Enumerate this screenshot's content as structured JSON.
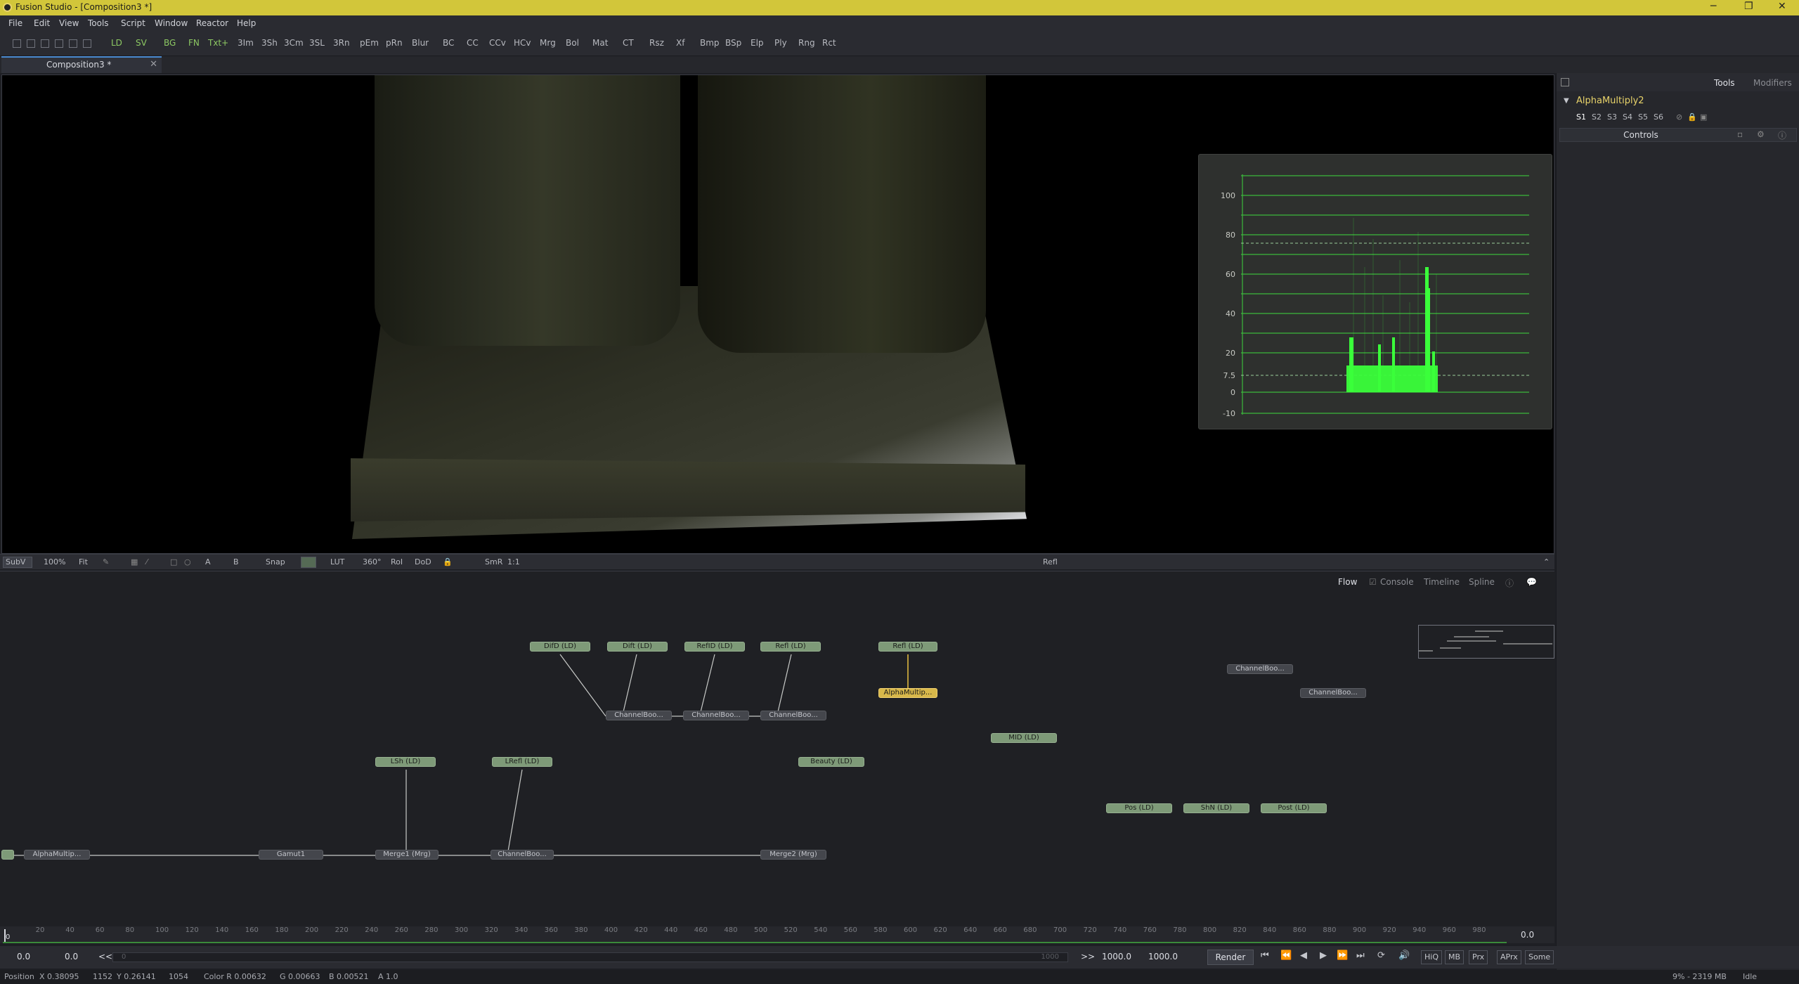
{
  "titlebar": {
    "title": "Fusion Studio - [Composition3 *]",
    "minimize": "─",
    "restore": "❐",
    "close": "✕"
  },
  "menu": [
    "File",
    "Edit",
    "View",
    "Tools",
    "Script",
    "Window",
    "Reactor",
    "Help"
  ],
  "toolbar": [
    "LD",
    "SV",
    "BG",
    "FN",
    "Txt+",
    "3Im",
    "3Sh",
    "3Cm",
    "3SL",
    "3Rn",
    "pEm",
    "pRn",
    "Blur",
    "BC",
    "CC",
    "CCv",
    "HCv",
    "Mrg",
    "Bol",
    "Mat",
    "CT",
    "Rsz",
    "Xf",
    "Bmp",
    "BSp",
    "Elp",
    "Ply",
    "Rng",
    "Rct"
  ],
  "tab": {
    "label": "Composition3 *",
    "close": "✕"
  },
  "scope": {
    "labels": [
      "100",
      "80",
      "60",
      "40",
      "20",
      "7.5",
      "0",
      "-10"
    ]
  },
  "viewer_toolbar": {
    "subv": "SubV",
    "zoom": "100%",
    "fit": "Fit",
    "a": "A",
    "b": "B",
    "snap": "Snap",
    "lut": "LUT",
    "deg": "360°",
    "roi": "RoI",
    "dod": "DoD",
    "smr": "SmR",
    "ratio": "1:1",
    "center_label": "Refl",
    "expand": "⌃"
  },
  "inspector": {
    "tabs": [
      "Tools",
      "Modifiers"
    ],
    "title": "AlphaMultiply2",
    "versions": [
      "S1",
      "S2",
      "S3",
      "S4",
      "S5",
      "S6"
    ],
    "controls_label": "Controls"
  },
  "flow": {
    "tabs": [
      "Flow",
      "Console",
      "Timeline",
      "Spline"
    ],
    "nodes": [
      "DifD (LD)",
      "Dift (LD)",
      "RefID (LD)",
      "Refl (LD)",
      "Refl (LD)",
      "AlphaMultip...",
      "ChannelBoo...",
      "ChannelBoo...",
      "ChannelBoo...",
      "ChannelBoo...",
      "ChannelBoo...",
      "MID (LD)",
      "LSh (LD)",
      "LRefl (LD)",
      "Beauty (LD)",
      "Pos (LD)",
      "ShN (LD)",
      "Post (LD)",
      "AlphaMultip...",
      "Gamut1",
      "Merge1 (Mrg)",
      "ChannelBoo...",
      "Merge2 (Mrg)"
    ]
  },
  "ruler": {
    "ticks": [
      "0",
      "20",
      "40",
      "60",
      "80",
      "100",
      "120",
      "140",
      "160",
      "180",
      "200",
      "220",
      "240",
      "260",
      "280",
      "300",
      "320",
      "340",
      "360",
      "380",
      "400",
      "420",
      "440",
      "460",
      "480",
      "500",
      "520",
      "540",
      "560",
      "580",
      "600",
      "620",
      "640",
      "660",
      "680",
      "700",
      "720",
      "740",
      "760",
      "780",
      "800",
      "820",
      "840",
      "860",
      "880",
      "900",
      "920",
      "940",
      "960",
      "980"
    ],
    "current": "0.0"
  },
  "transport": {
    "start": "0.0",
    "render_start": "0.0",
    "rewind": "<<",
    "scrub_start": "0",
    "scrub_end": "1000",
    "fwd": ">>",
    "render_end": "1000.0",
    "end": "1000.0",
    "render": "Render",
    "hiq": "HiQ",
    "mb": "MB",
    "prx": "Prx",
    "aprx": "APrx",
    "some": "Some"
  },
  "status": {
    "position_label": "Position",
    "x": "X 0.38095",
    "px": "1152",
    "y": "Y 0.26141",
    "py": "1054",
    "color_r": "Color R 0.00632",
    "g": "G 0.00663",
    "b": "B 0.00521",
    "a": "A 1.0",
    "memory": "9% - 2319 MB",
    "state": "Idle"
  }
}
